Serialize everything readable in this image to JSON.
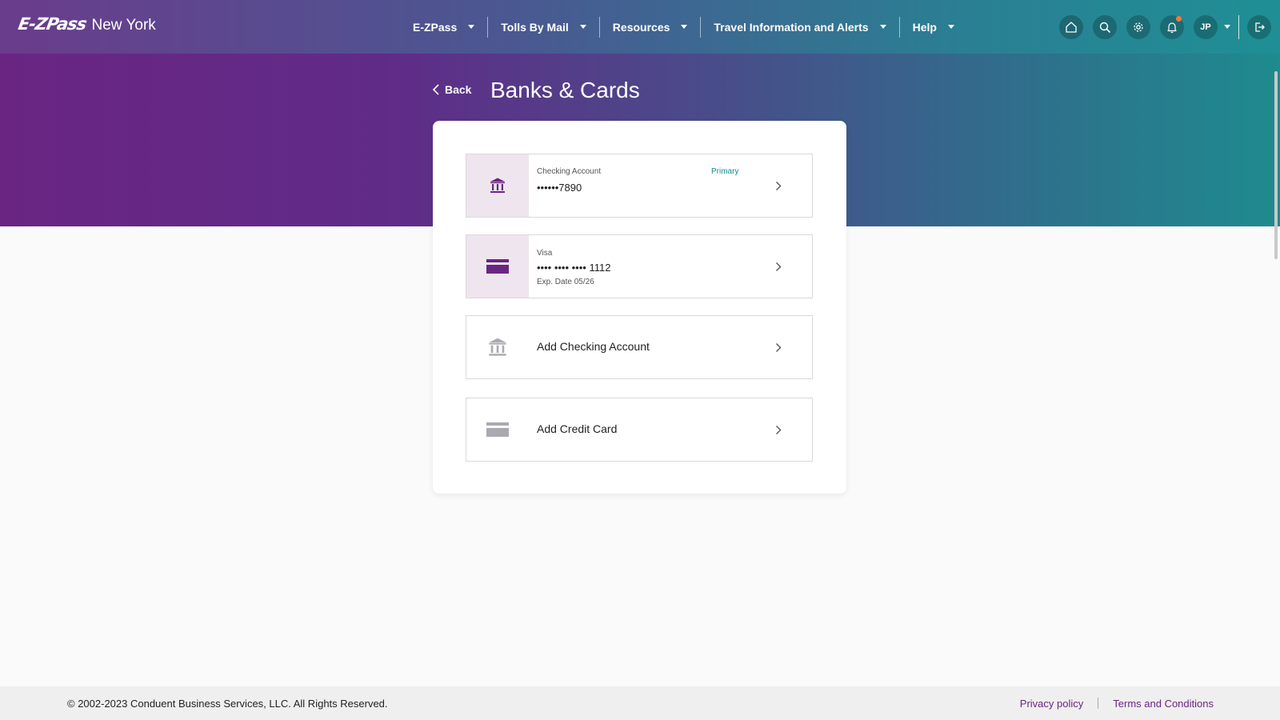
{
  "header": {
    "logo_mark": "E-ZPass",
    "logo_text": "New York",
    "nav": [
      {
        "label": "E-ZPass"
      },
      {
        "label": "Tolls By Mail"
      },
      {
        "label": "Resources"
      },
      {
        "label": "Travel Information and Alerts"
      },
      {
        "label": "Help"
      }
    ],
    "avatar_initials": "JP"
  },
  "page": {
    "back_label": "Back",
    "title": "Banks & Cards"
  },
  "methods": [
    {
      "type_label": "Checking Account",
      "masked": "••••••7890",
      "badge": "Primary"
    },
    {
      "type_label": "Visa",
      "masked": "•••• •••• •••• 1112",
      "exp": "Exp. Date 05/26"
    }
  ],
  "actions": {
    "add_checking": "Add Checking Account",
    "add_card": "Add Credit Card"
  },
  "footer": {
    "copyright": "© 2002-2023 Conduent Business Services, LLC. All Rights Reserved.",
    "privacy": "Privacy policy",
    "terms": "Terms and Conditions"
  },
  "colors": {
    "brand_purple": "#6a2583",
    "teal": "#1e8b8e",
    "primary_badge": "#1a8a8a",
    "icon_bg": "#efe5ee",
    "notification_dot": "#f37a3a"
  }
}
